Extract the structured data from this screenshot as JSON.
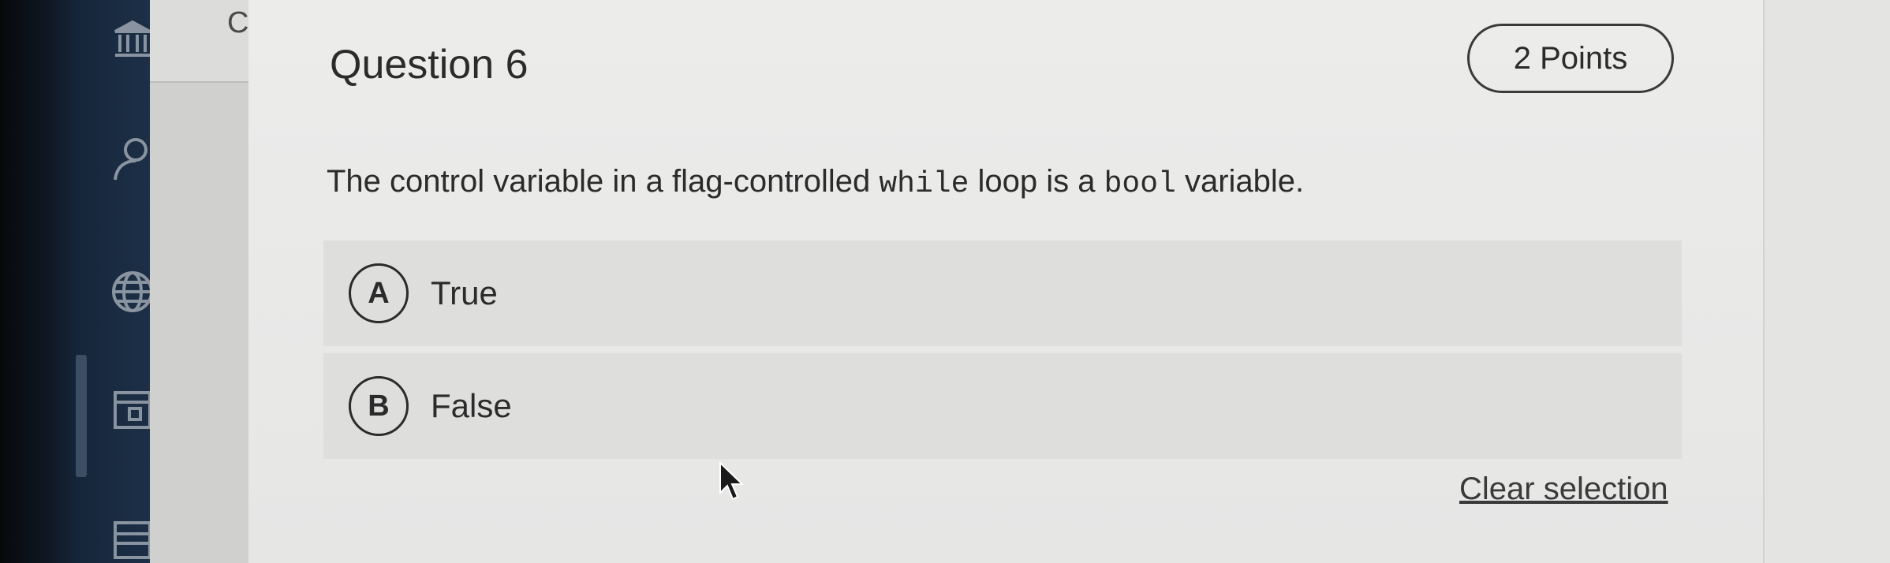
{
  "course_label": "Co",
  "question": {
    "title": "Question 6",
    "points": "2 Points",
    "prompt_before": "The control variable in a flag-controlled ",
    "prompt_code_1": "while",
    "prompt_middle": " loop is a ",
    "prompt_code_2": "bool",
    "prompt_after": " variable."
  },
  "options": [
    {
      "letter": "A",
      "label": "True"
    },
    {
      "letter": "B",
      "label": "False"
    }
  ],
  "clear_selection": "Clear selection",
  "nav_icons": [
    "institution-icon",
    "account-icon",
    "globe-icon",
    "calendar-icon",
    "inbox-icon"
  ]
}
